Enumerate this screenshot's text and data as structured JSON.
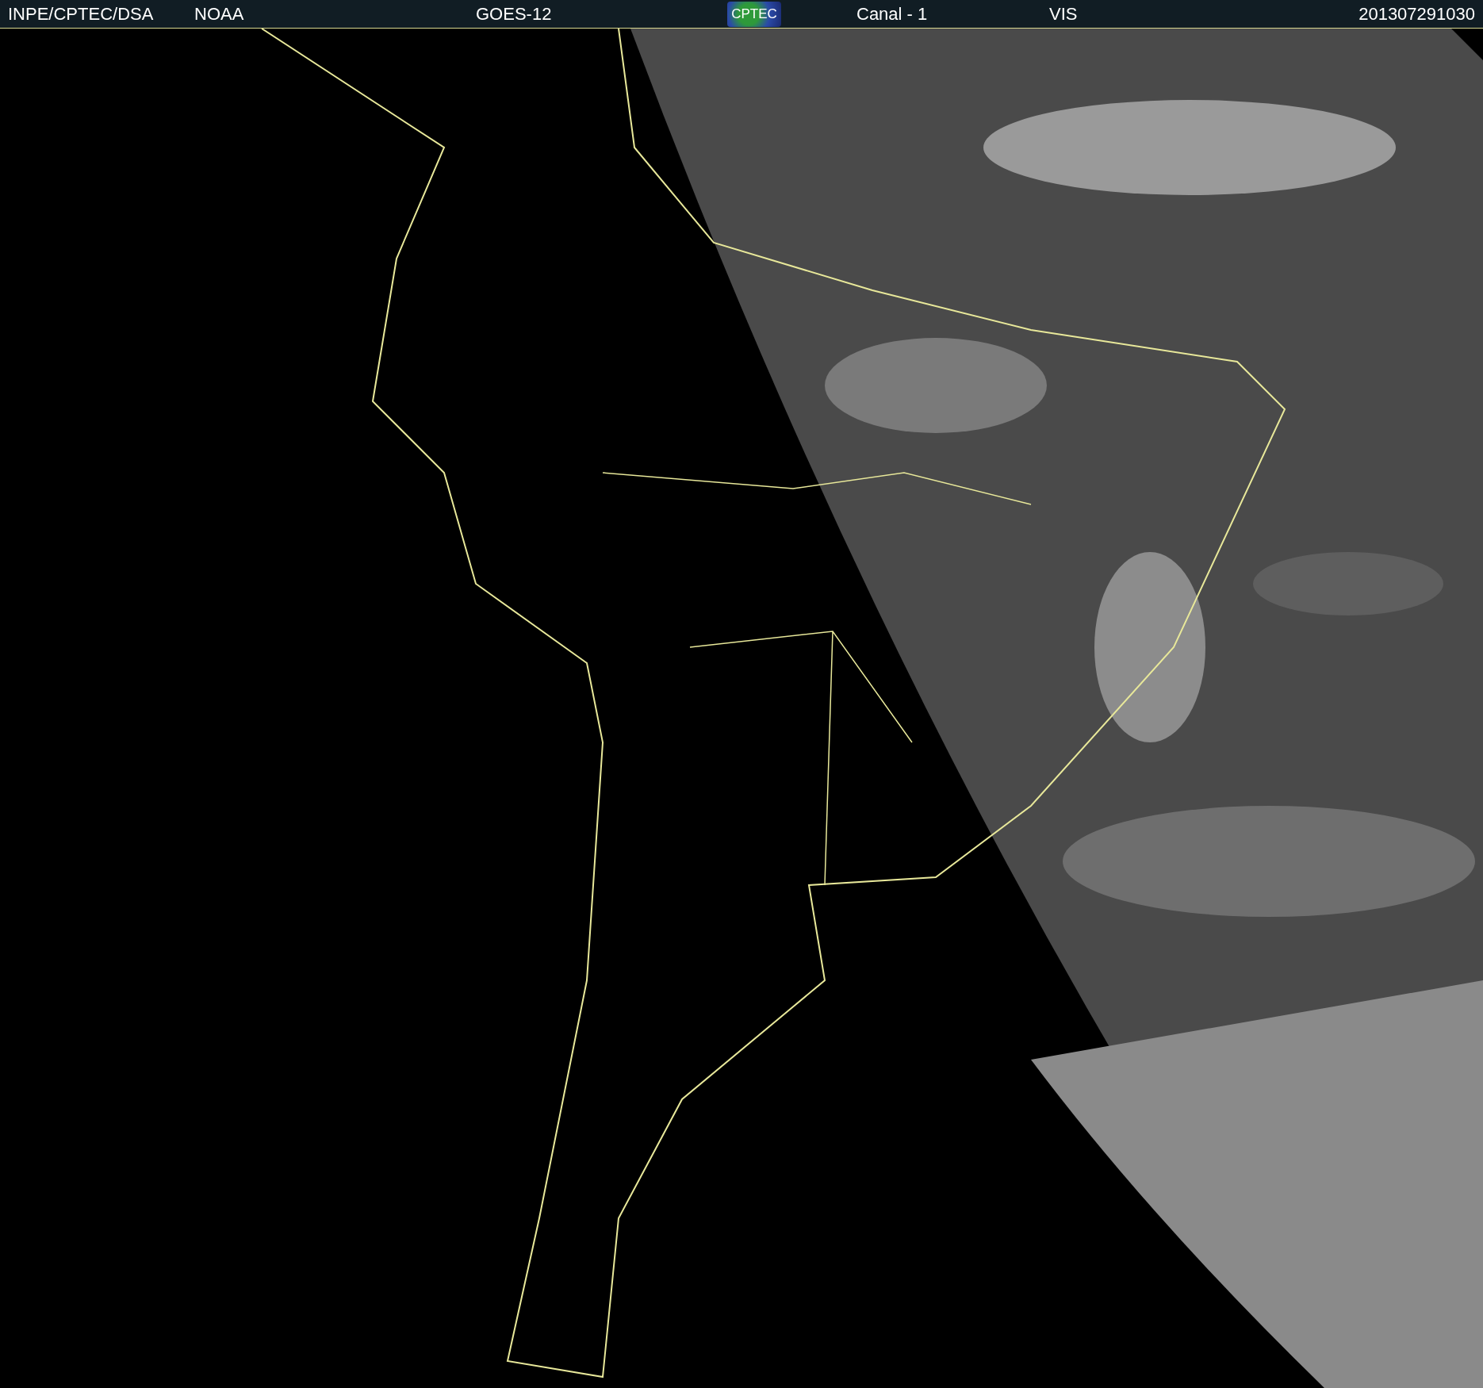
{
  "header": {
    "items": [
      {
        "kind": "text",
        "text": "INPE/CPTEC/DSA"
      },
      {
        "kind": "text",
        "text": "NOAA"
      },
      {
        "kind": "text",
        "text": "GOES-12"
      },
      {
        "kind": "logo",
        "text": "CPTEC"
      },
      {
        "kind": "text",
        "text": "Canal - 1"
      },
      {
        "kind": "text",
        "text": "VIS"
      },
      {
        "kind": "text",
        "text": "201307291030"
      }
    ]
  }
}
